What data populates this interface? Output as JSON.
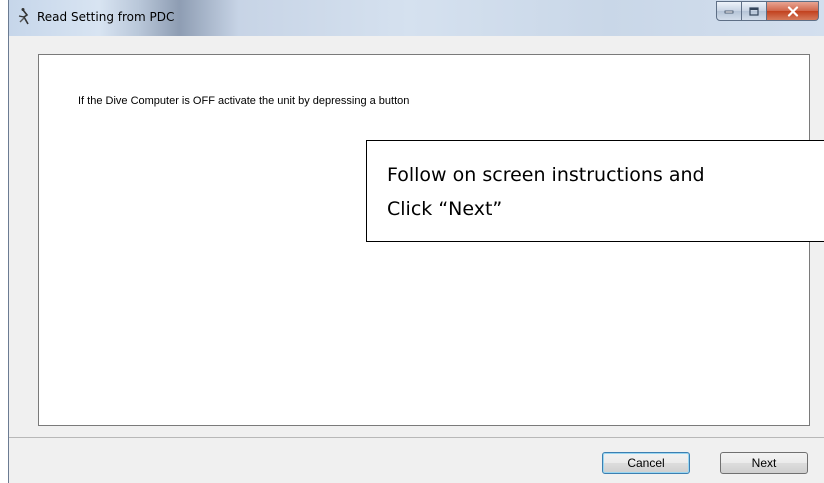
{
  "window": {
    "title": "Read Setting from PDC",
    "controls": {
      "minimize": "minimize",
      "maximize": "maximize",
      "close": "close"
    }
  },
  "main": {
    "instruction": "If the Dive Computer is OFF activate the unit by depressing a button"
  },
  "callout": {
    "line1": "Follow on screen instructions and",
    "line2": "Click “Next”"
  },
  "footer": {
    "cancel_label": "Cancel",
    "next_label": "Next"
  },
  "colors": {
    "titlebar": "#c9d7e8",
    "close_button": "#c2411e",
    "dialog_background": "#f0f0f0"
  }
}
